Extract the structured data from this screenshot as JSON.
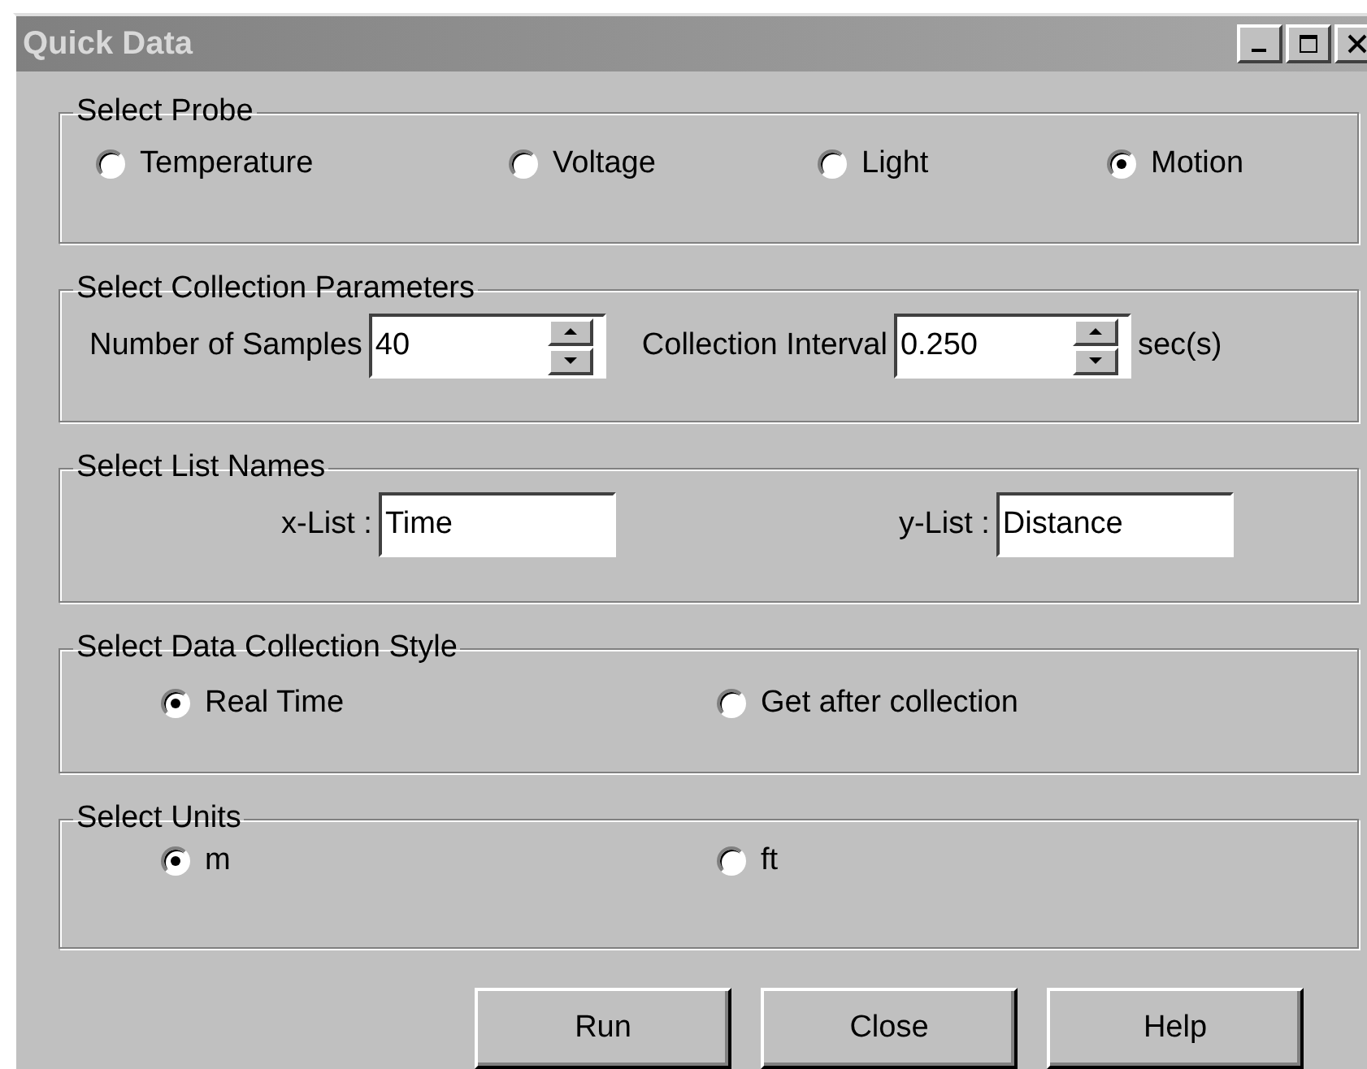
{
  "window": {
    "title": "Quick Data"
  },
  "probe_group": {
    "title": "Select Probe",
    "options": [
      {
        "label": "Temperature",
        "selected": false
      },
      {
        "label": "Voltage",
        "selected": false
      },
      {
        "label": "Light",
        "selected": false
      },
      {
        "label": "Motion",
        "selected": true
      }
    ]
  },
  "parameters_group": {
    "title": "Select Collection Parameters",
    "fields": [
      {
        "label": "Number of Samples",
        "value": "40"
      },
      {
        "label": "Collection Interval",
        "value": "0.250",
        "unit": "sec(s)"
      }
    ]
  },
  "list_names_group": {
    "title": "Select List Names",
    "fields": [
      {
        "label": "x-List :",
        "value": "Time"
      },
      {
        "label": "y-List :",
        "value": "Distance"
      }
    ]
  },
  "style_group": {
    "title": "Select Data Collection Style",
    "options": [
      {
        "label": "Real Time",
        "selected": true
      },
      {
        "label": "Get after collection",
        "selected": false
      }
    ]
  },
  "units_group": {
    "title": "Select Units",
    "options": [
      {
        "label": "m",
        "selected": true
      },
      {
        "label": "ft",
        "selected": false
      }
    ]
  },
  "buttons": [
    {
      "label": "Run"
    },
    {
      "label": "Close"
    },
    {
      "label": "Help"
    }
  ]
}
